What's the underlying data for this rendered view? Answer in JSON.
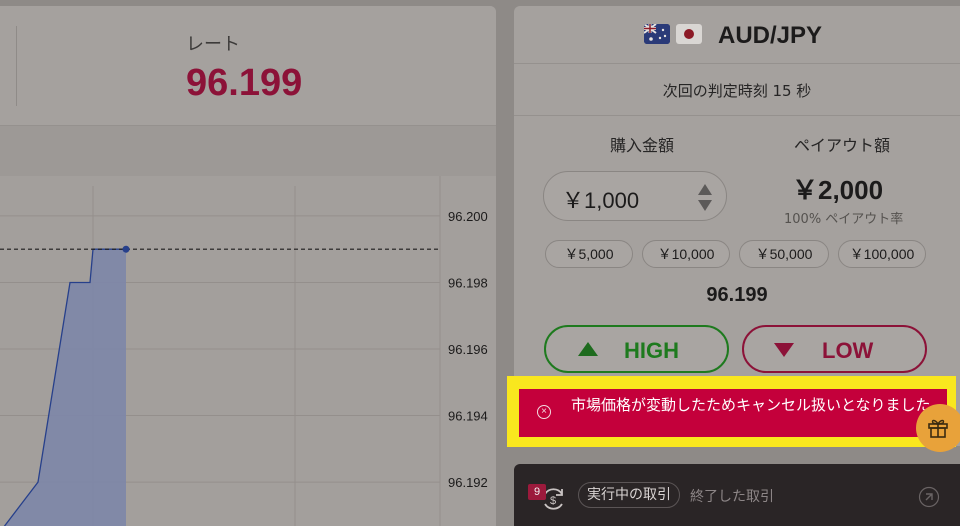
{
  "rate": {
    "label": "レート",
    "value": "96.199"
  },
  "chart_data": {
    "type": "area",
    "x": [
      0,
      1,
      2,
      3,
      4,
      5,
      6,
      7
    ],
    "y": [
      96.1905,
      96.1915,
      96.192,
      96.198,
      96.198,
      96.199,
      96.199,
      96.199
    ],
    "ytick_labels": [
      "96.200",
      "96.198",
      "96.196",
      "96.194",
      "96.192"
    ],
    "ylim": [
      96.1905,
      96.2012
    ],
    "current_line": 96.199,
    "color": "#27408b",
    "fill": "#7d86a8"
  },
  "trade": {
    "pair": "AUD/JPY",
    "flags": [
      "australia-flag-icon",
      "japan-flag-icon"
    ],
    "timer_text": "次回の判定時刻 15 秒",
    "amount_label": "購入金額",
    "amount_value": "￥1,000",
    "payout_label": "ペイアウト額",
    "payout_value": "￥2,000",
    "payout_rate": "100% ペイアウト率",
    "presets": [
      "￥5,000",
      "￥10,000",
      "￥50,000",
      "￥100,000"
    ],
    "current_price": "96.199",
    "high_label": "HIGH",
    "low_label": "LOW"
  },
  "toast": {
    "message": "市場価格が変動したためキャンセル扱いとなりました。"
  },
  "trades_bar": {
    "count": "9",
    "active_tab": "実行中の取引",
    "inactive_tab": "終了した取引"
  },
  "colors": {
    "accent_red": "#8c1238",
    "high_green": "#1e7a1e",
    "toast_bg": "#c4003b",
    "highlight": "#f9e71e"
  }
}
